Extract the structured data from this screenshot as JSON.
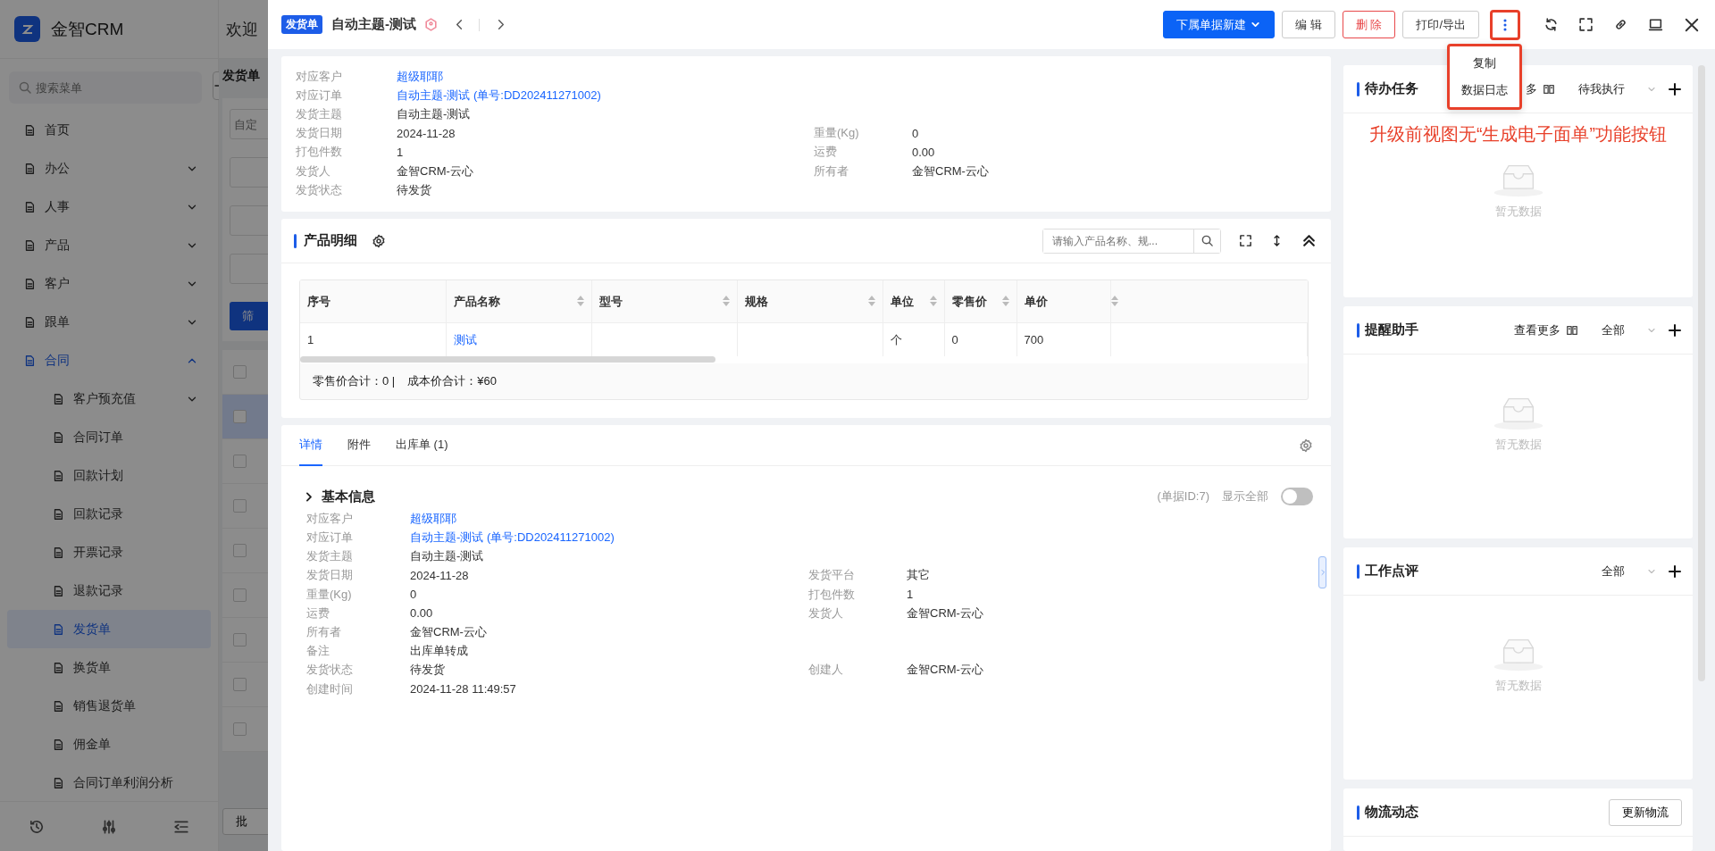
{
  "background": {
    "app_name": "金智CRM",
    "welcome": "欢迎",
    "search_placeholder": "搜索菜单",
    "page_title": "发货单",
    "filter_placeholder": "自定",
    "filter_button": "筛",
    "batch_button": "批",
    "record_rows": [
      {
        "checked": false,
        "selected": false
      },
      {
        "checked": false,
        "selected": true
      },
      {
        "checked": false,
        "selected": false
      },
      {
        "checked": false,
        "selected": false
      },
      {
        "checked": false,
        "selected": false
      },
      {
        "checked": false,
        "selected": false
      },
      {
        "checked": false,
        "selected": false
      },
      {
        "checked": false,
        "selected": false
      },
      {
        "checked": false,
        "selected": false
      }
    ],
    "menu": [
      {
        "label": "首页",
        "kind": "link",
        "selected": false
      },
      {
        "label": "办公",
        "kind": "group",
        "expanded": false,
        "selected": false
      },
      {
        "label": "人事",
        "kind": "group",
        "expanded": false,
        "selected": false
      },
      {
        "label": "产品",
        "kind": "group",
        "expanded": false,
        "selected": false
      },
      {
        "label": "客户",
        "kind": "group",
        "expanded": false,
        "selected": false
      },
      {
        "label": "跟单",
        "kind": "group",
        "expanded": false,
        "selected": false
      },
      {
        "label": "合同",
        "kind": "group",
        "expanded": true,
        "selected": false,
        "children": [
          {
            "label": "客户预充值",
            "kind": "group",
            "expanded": false,
            "selected": false
          },
          {
            "label": "合同订单",
            "kind": "link",
            "selected": false
          },
          {
            "label": "回款计划",
            "kind": "link",
            "selected": false
          },
          {
            "label": "回款记录",
            "kind": "link",
            "selected": false
          },
          {
            "label": "开票记录",
            "kind": "link",
            "selected": false
          },
          {
            "label": "退款记录",
            "kind": "link",
            "selected": false
          },
          {
            "label": "发货单",
            "kind": "link",
            "selected": true
          },
          {
            "label": "换货单",
            "kind": "link",
            "selected": false
          },
          {
            "label": "销售退货单",
            "kind": "link",
            "selected": false
          },
          {
            "label": "佣金单",
            "kind": "link",
            "selected": false
          },
          {
            "label": "合同订单利润分析",
            "kind": "link",
            "selected": false
          }
        ]
      }
    ]
  },
  "drawer": {
    "tag": "发货单",
    "title": "自动主题-测试",
    "buttons": [
      {
        "label": "下属单据新建",
        "kind": "primary"
      },
      {
        "label": "编 辑",
        "kind": "default"
      },
      {
        "label": "删 除",
        "kind": "danger"
      },
      {
        "label": "打印/导出",
        "kind": "default"
      }
    ],
    "more_menu": {
      "open": true,
      "highlighted": true,
      "items": [
        "复制",
        "数据日志"
      ]
    },
    "summary": [
      {
        "left": {
          "label": "对应客户",
          "value": "超级耶耶",
          "kind": "link"
        }
      },
      {
        "left": {
          "label": "对应订单",
          "value": "自动主题-测试 (单号:DD202411271002)",
          "kind": "link"
        }
      },
      {
        "left": {
          "label": "发货主题",
          "value": "自动主题-测试",
          "kind": "text"
        }
      },
      {
        "left": {
          "label": "发货日期",
          "value": "2024-11-28",
          "kind": "text"
        },
        "right": {
          "label": "重量(Kg)",
          "value": "0",
          "kind": "text"
        }
      },
      {
        "left": {
          "label": "打包件数",
          "value": "1",
          "kind": "text"
        },
        "right": {
          "label": "运费",
          "value": "0.00",
          "kind": "text"
        }
      },
      {
        "left": {
          "label": "发货人",
          "value": "金智CRM-云心",
          "kind": "text"
        },
        "right": {
          "label": "所有者",
          "value": "金智CRM-云心",
          "kind": "text"
        }
      },
      {
        "left": {
          "label": "发货状态",
          "value": "待发货",
          "kind": "text"
        }
      }
    ],
    "products": {
      "title": "产品明细",
      "search_placeholder": "请输入产品名称、规...",
      "columns": [
        {
          "label": "序号",
          "sortable": false
        },
        {
          "label": "产品名称",
          "sortable": true
        },
        {
          "label": "型号",
          "sortable": true
        },
        {
          "label": "规格",
          "sortable": true
        },
        {
          "label": "单位",
          "sortable": true
        },
        {
          "label": "零售价",
          "sortable": true
        },
        {
          "label": "单价",
          "sortable": false
        }
      ],
      "rows": [
        [
          "1",
          "测试",
          "",
          "",
          "个",
          "0",
          "700"
        ]
      ],
      "totals": [
        "零售价合计：0 |",
        "成本价合计：¥60"
      ]
    },
    "tabs": [
      {
        "label": "详情",
        "selected": true
      },
      {
        "label": "附件",
        "selected": false
      },
      {
        "label": "出库单 (1)",
        "selected": false
      }
    ],
    "basic_info": {
      "title": "基本信息",
      "record_id": "(单据ID:7)",
      "show_all": {
        "label": "显示全部",
        "on": false
      },
      "rows": [
        {
          "left": {
            "label": "对应客户",
            "value": "超级耶耶",
            "kind": "link"
          }
        },
        {
          "left": {
            "label": "对应订单",
            "value": "自动主题-测试 (单号:DD202411271002)",
            "kind": "link"
          }
        },
        {
          "left": {
            "label": "发货主题",
            "value": "自动主题-测试",
            "kind": "text"
          }
        },
        {
          "left": {
            "label": "发货日期",
            "value": "2024-11-28",
            "kind": "text"
          },
          "right": {
            "label": "发货平台",
            "value": "其它",
            "kind": "text"
          }
        },
        {
          "left": {
            "label": "重量(Kg)",
            "value": "0",
            "kind": "text"
          },
          "right": {
            "label": "打包件数",
            "value": "1",
            "kind": "text"
          }
        },
        {
          "left": {
            "label": "运费",
            "value": "0.00",
            "kind": "text"
          },
          "right": {
            "label": "发货人",
            "value": "金智CRM-云心",
            "kind": "text"
          }
        },
        {
          "left": {
            "label": "所有者",
            "value": "金智CRM-云心",
            "kind": "text"
          }
        },
        {
          "left": {
            "label": "备注",
            "value": "出库单转成",
            "kind": "text"
          }
        },
        {
          "left": {
            "label": "发货状态",
            "value": "待发货",
            "kind": "text"
          },
          "right": {
            "label": "创建人",
            "value": "金智CRM-云心",
            "kind": "text"
          }
        },
        {
          "left": {
            "label": "创建时间",
            "value": "2024-11-28 11:49:57",
            "kind": "text"
          }
        }
      ]
    },
    "panels": [
      {
        "title": "待办任务",
        "more": "多",
        "filter": "待我执行",
        "kind": "list",
        "annotation": "升级前视图无“生成电子面单”功能按钮",
        "empty": "暂无数据"
      },
      {
        "title": "提醒助手",
        "more": "查看更多",
        "filter": "全部",
        "kind": "list",
        "empty": "暂无数据"
      },
      {
        "title": "工作点评",
        "filter": "全部",
        "kind": "list",
        "empty": "暂无数据"
      },
      {
        "title": "物流动态",
        "button": "更新物流",
        "kind": "action"
      }
    ]
  }
}
